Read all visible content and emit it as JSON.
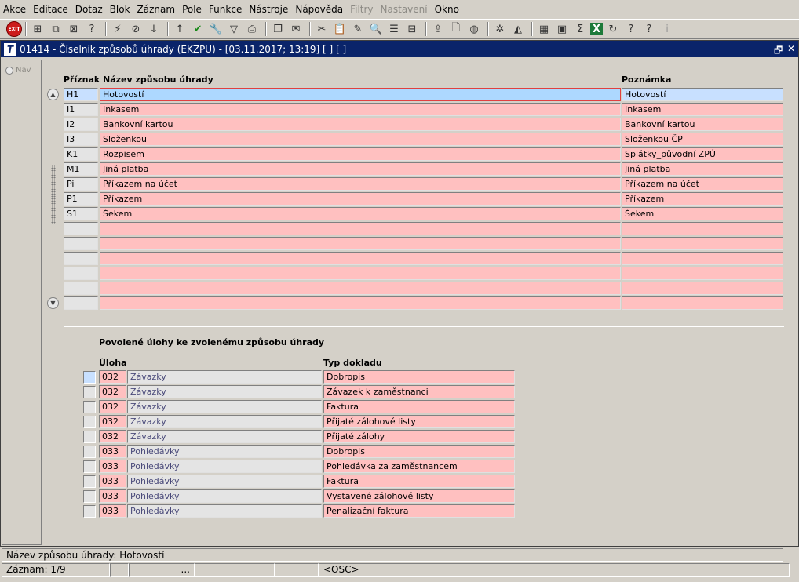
{
  "menu": [
    "Akce",
    "Editace",
    "Dotaz",
    "Blok",
    "Záznam",
    "Pole",
    "Funkce",
    "Nástroje",
    "Nápověda",
    "Filtry",
    "Nastavení",
    "Okno"
  ],
  "menu_disabled": [
    "Filtry",
    "Nastavení"
  ],
  "toolbar": {
    "exit_label": "EXIT",
    "icons": [
      "insert-record-icon",
      "duplicate-record-icon",
      "delete-record-icon",
      "enter-query-icon",
      "execute-query-icon",
      "cancel-query-icon",
      "sort-asc-icon",
      "sort-desc-icon",
      "accept-icon",
      "tools-icon",
      "filter-icon",
      "print-icon",
      "copy-icon",
      "mail-icon",
      "cut-icon",
      "paste-icon",
      "edit-icon",
      "search-icon",
      "list-icon",
      "tree-icon",
      "export-icon",
      "document-icon",
      "globe-icon",
      "settings-icon",
      "chart-icon",
      "graph-icon",
      "calculator-icon",
      "sum-icon",
      "excel-icon",
      "refresh-icon",
      "help-context-icon",
      "help-icon",
      "info-icon"
    ]
  },
  "window": {
    "title": "01414 - Číselník způsobů úhrady (EKZPU) - [03.11.2017; 13:19]  [ ]  [ ]",
    "app_icon_text": "T",
    "restore_glyph": "🗗",
    "close_glyph": "✕"
  },
  "nav_label": "Nav",
  "master": {
    "headers": {
      "code": "Příznak",
      "name": "Název způsobu úhrady",
      "note": "Poznámka"
    },
    "rows": [
      {
        "code": "H1",
        "name": "Hotovostí",
        "note": "Hotovostí"
      },
      {
        "code": "I1",
        "name": "Inkasem",
        "note": "Inkasem"
      },
      {
        "code": "I2",
        "name": "Bankovní kartou",
        "note": "Bankovní kartou"
      },
      {
        "code": "I3",
        "name": "Složenkou",
        "note": "Složenkou ČP"
      },
      {
        "code": "K1",
        "name": "Rozpisem",
        "note": "Splátky_původní ZPÚ"
      },
      {
        "code": "M1",
        "name": "Jiná platba",
        "note": "Jiná platba"
      },
      {
        "code": "Pi",
        "name": "Příkazem na účet",
        "note": "Příkazem na účet"
      },
      {
        "code": "P1",
        "name": "Příkazem",
        "note": "Příkazem"
      },
      {
        "code": "S1",
        "name": "Šekem",
        "note": "Šekem"
      },
      {
        "code": "",
        "name": "",
        "note": ""
      },
      {
        "code": "",
        "name": "",
        "note": ""
      },
      {
        "code": "",
        "name": "",
        "note": ""
      },
      {
        "code": "",
        "name": "",
        "note": ""
      },
      {
        "code": "",
        "name": "",
        "note": ""
      },
      {
        "code": "",
        "name": "",
        "note": ""
      }
    ]
  },
  "detail": {
    "section_title": "Povolené úlohy ke zvolenému způsobu úhrady",
    "headers": {
      "task": "Úloha",
      "doc_type": "Typ dokladu"
    },
    "rows": [
      {
        "code": "032",
        "task": "Závazky",
        "doc_type": "Dobropis"
      },
      {
        "code": "032",
        "task": "Závazky",
        "doc_type": "Závazek k zaměstnanci"
      },
      {
        "code": "032",
        "task": "Závazky",
        "doc_type": "Faktura"
      },
      {
        "code": "032",
        "task": "Závazky",
        "doc_type": "Přijaté zálohové listy"
      },
      {
        "code": "032",
        "task": "Závazky",
        "doc_type": "Přijaté zálohy"
      },
      {
        "code": "033",
        "task": "Pohledávky",
        "doc_type": "Dobropis"
      },
      {
        "code": "033",
        "task": "Pohledávky",
        "doc_type": "Pohledávka za zaměstnancem"
      },
      {
        "code": "033",
        "task": "Pohledávky",
        "doc_type": "Faktura"
      },
      {
        "code": "033",
        "task": "Pohledávky",
        "doc_type": "Vystavené zálohové listy"
      },
      {
        "code": "033",
        "task": "Pohledávky",
        "doc_type": "Penalizační faktura"
      }
    ]
  },
  "status": {
    "hint": "Název způsobu úhrady: Hotovostí",
    "record": "Záznam: 1/9",
    "ellipsis": "...",
    "mode": "<OSC>"
  }
}
